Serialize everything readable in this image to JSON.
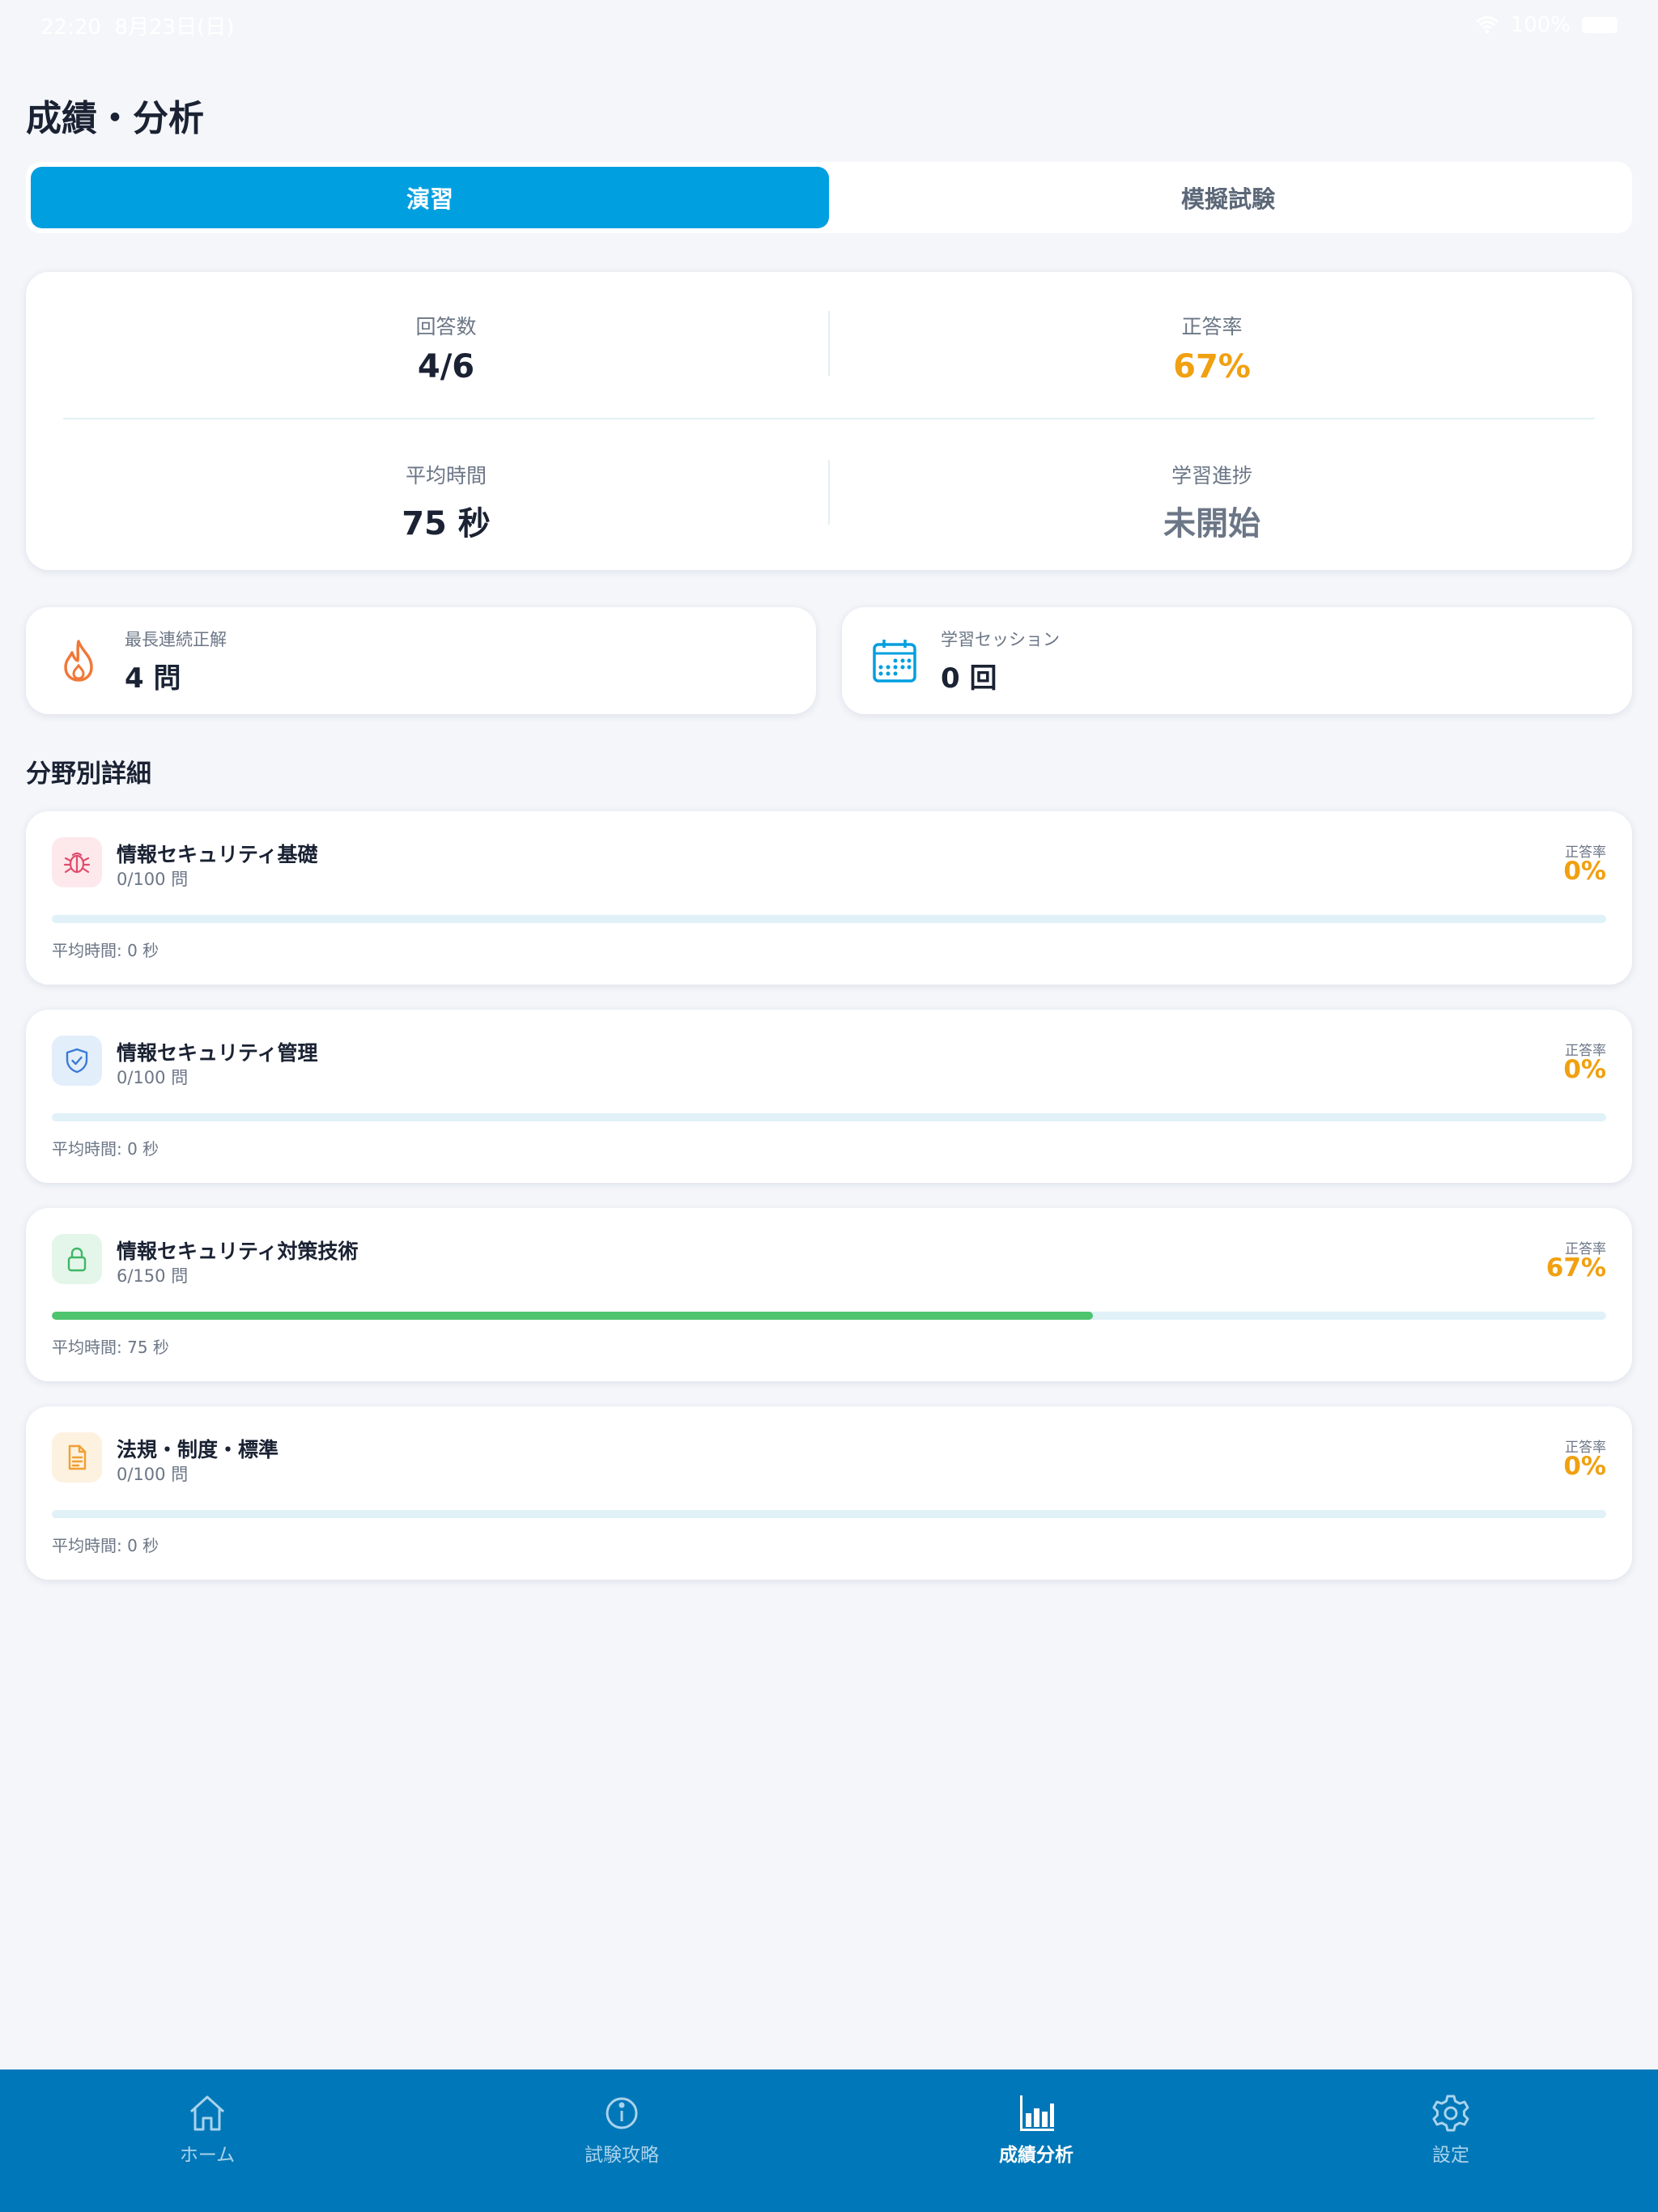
{
  "status": {
    "time": "22:20",
    "date": "8月23日(日)",
    "battery": "100%"
  },
  "page": {
    "title": "成績・分析"
  },
  "segments": [
    {
      "label": "演習",
      "active": true
    },
    {
      "label": "模擬試験",
      "active": false
    }
  ],
  "summary": {
    "answers": {
      "label": "回答数",
      "value": "4/6"
    },
    "accuracy": {
      "label": "正答率",
      "value": "67%"
    },
    "avg_time": {
      "label": "平均時間",
      "value": "75 秒"
    },
    "progress": {
      "label": "学習進捗",
      "value": "未開始"
    }
  },
  "streak": {
    "label": "最長連続正解",
    "value": "4 問",
    "icon": "flame-icon"
  },
  "sessions": {
    "label": "学習セッション",
    "value": "0 回",
    "icon": "calendar-icon"
  },
  "section_title": "分野別詳細",
  "categories": [
    {
      "name": "情報セキュリティ基礎",
      "count": "0/100 問",
      "rate_label": "正答率",
      "rate": "0%",
      "progress": 0.0,
      "time": "平均時間: 0 秒",
      "icon": "bug-icon"
    },
    {
      "name": "情報セキュリティ管理",
      "count": "0/100 問",
      "rate_label": "正答率",
      "rate": "0%",
      "progress": 0.0,
      "time": "平均時間: 0 秒",
      "icon": "shield-check-icon"
    },
    {
      "name": "情報セキュリティ対策技術",
      "count": "6/150 問",
      "rate_label": "正答率",
      "rate": "67%",
      "progress": 0.67,
      "time": "平均時間: 75 秒",
      "icon": "lock-icon"
    },
    {
      "name": "法規・制度・標準",
      "count": "0/100 問",
      "rate_label": "正答率",
      "rate": "0%",
      "progress": 0.0,
      "time": "平均時間: 0 秒",
      "icon": "document-icon"
    }
  ],
  "tabs": [
    {
      "label": "ホーム",
      "icon": "home-icon",
      "active": false
    },
    {
      "label": "試験攻略",
      "icon": "info-icon",
      "active": false
    },
    {
      "label": "成績分析",
      "icon": "bar-chart-icon",
      "active": true
    },
    {
      "label": "設定",
      "icon": "gear-icon",
      "active": false
    }
  ],
  "colors": {
    "accent": "#009fe0",
    "tabbar": "#0077b8",
    "rate": "#f0a010",
    "progress": "#4ec46e",
    "flame": "#f07838"
  }
}
